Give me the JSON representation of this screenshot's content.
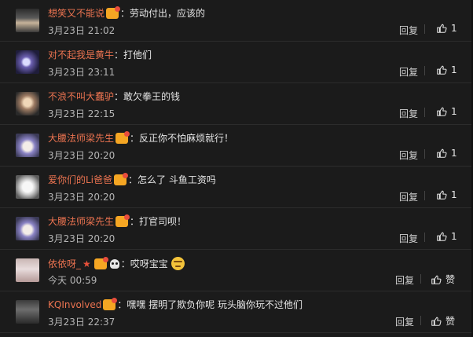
{
  "comments": [
    {
      "user": "想笑又不能说",
      "badges": [
        "vip"
      ],
      "text": "：劳动付出，应该的",
      "time": "3月23日 21:02",
      "reply": "回复",
      "likes": "1",
      "avatar": "a1"
    },
    {
      "user": "对不起我是黄牛",
      "badges": [],
      "text": "：打他们",
      "time": "3月23日 23:11",
      "reply": "回复",
      "likes": "1",
      "avatar": "a2"
    },
    {
      "user": "不浪不叫大蠢驴",
      "badges": [],
      "text": "：敢欠拳王的钱",
      "time": "3月23日 22:15",
      "reply": "回复",
      "likes": "1",
      "avatar": "a3"
    },
    {
      "user": "大腰法师梁先生",
      "badges": [
        "vip"
      ],
      "text": "：反正你不怕麻烦就行！",
      "time": "3月23日 20:20",
      "reply": "回复",
      "likes": "1",
      "avatar": "a4"
    },
    {
      "user": "爱你们的Li爸爸",
      "badges": [
        "vip"
      ],
      "text": "：怎么了  斗鱼工资吗",
      "time": "3月23日 20:20",
      "reply": "回复",
      "likes": "1",
      "avatar": "a5"
    },
    {
      "user": "大腰法师梁先生",
      "badges": [
        "vip"
      ],
      "text": "：打官司呗！",
      "time": "3月23日 20:20",
      "reply": "回复",
      "likes": "1",
      "avatar": "a4"
    },
    {
      "user": "依依呀_",
      "badges": [
        "star",
        "vip",
        "skull"
      ],
      "text": "：哎呀宝宝",
      "emoji": true,
      "time": "今天 00:59",
      "reply": "回复",
      "likes": "赞",
      "avatar": "a7"
    },
    {
      "user": "KQInvolved",
      "badges": [
        "vip"
      ],
      "text": "：嘿嘿 摆明了欺负你呢 玩头脑你玩不过他们",
      "time": "3月23日 22:37",
      "reply": "回复",
      "likes": "赞",
      "avatar": "a8"
    }
  ],
  "colors": {
    "username": "#eb7350",
    "background": "#1b1b1b",
    "text": "#e6e6e6",
    "meta": "#b5b5b5"
  },
  "icons": {
    "like": "thumbs-up-icon",
    "badge": "vip-badge-icon"
  }
}
